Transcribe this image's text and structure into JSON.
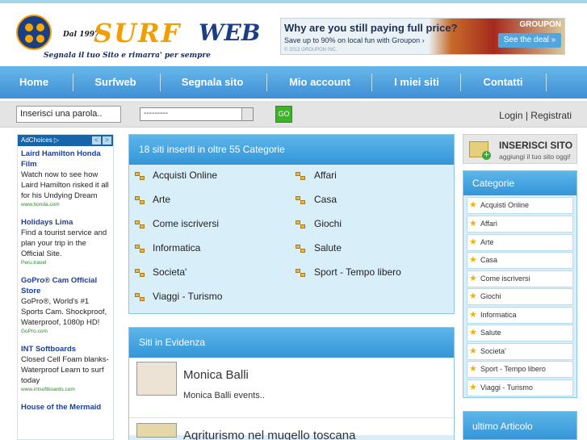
{
  "header": {
    "logo_since": "Dal 1997",
    "logo_surf": "SURF",
    "logo_web": "WEB",
    "tagline": "Segnala il tuo Sito e rimarra' per sempre"
  },
  "banner": {
    "headline": "Why are you still paying full price?",
    "subline": "Save up to 90% on local fun with Groupon ›",
    "copyright": "© 2013 GROUPON INC.",
    "brand": "GROUPON",
    "cta": "See the deal »"
  },
  "nav": {
    "items": [
      "Home",
      "Surfweb",
      "Segnala sito",
      "Mio account",
      "I miei siti",
      "Contatti"
    ]
  },
  "search": {
    "input_value": "Inserisci una parola..",
    "select_value": "---------",
    "go_label": "GO",
    "login_text": "Login | Registrati"
  },
  "ads": {
    "header": "AdChoices ▷",
    "prev": "<",
    "next": ">",
    "items": [
      {
        "title": "Laird Hamilton Honda Film",
        "text": "Watch now to see how Laird Hamilton risked it all for his Undying Dream",
        "url": "www.honda.com"
      },
      {
        "title": "Holidays Lima",
        "text": "Find a tourist service and plan your trip in the Official Site.",
        "url": "Peru.travel"
      },
      {
        "title": "GoPro® Cam Official Store",
        "text": "GoPro®, World's #1 Sports Cam. Shockproof, Waterproof, 1080p HD!",
        "url": "GoPro.com"
      },
      {
        "title": "INT Softboards",
        "text": "Closed Cell Foam blanks- Waterproof Learn to surf today",
        "url": "www.intsoftboards.com"
      },
      {
        "title": "House of the Mermaid",
        "text": "",
        "url": ""
      }
    ]
  },
  "categories_box": {
    "title": "18 siti inseriti in oltre 55 Categorie",
    "left": [
      "Acquisti Online",
      "Arte",
      "Come iscriversi",
      "Informatica",
      "Societa'",
      "Viaggi - Turismo"
    ],
    "right": [
      "Affari",
      "Casa",
      "Giochi",
      "Salute",
      "Sport - Tempo libero"
    ]
  },
  "featured": {
    "title": "Siti in Evidenza",
    "items": [
      {
        "title": "Monica Balli",
        "desc": "Monica Balli events.."
      },
      {
        "title": "Agriturismo nel mugello toscana",
        "desc": ""
      }
    ]
  },
  "sidebar": {
    "inserisci_title": "INSERISCI SITO",
    "inserisci_sub": "aggiungi il tuo sito oggi!",
    "categorie_title": "Categorie",
    "categorie": [
      "Acquisti Online",
      "Affari",
      "Arte",
      "Casa",
      "Come iscriversi",
      "Giochi",
      "Informatica",
      "Salute",
      "Societa'",
      "Sport - Tempo libero",
      "Viaggi - Turismo"
    ],
    "ultimo_title": "ultimo Articolo"
  }
}
